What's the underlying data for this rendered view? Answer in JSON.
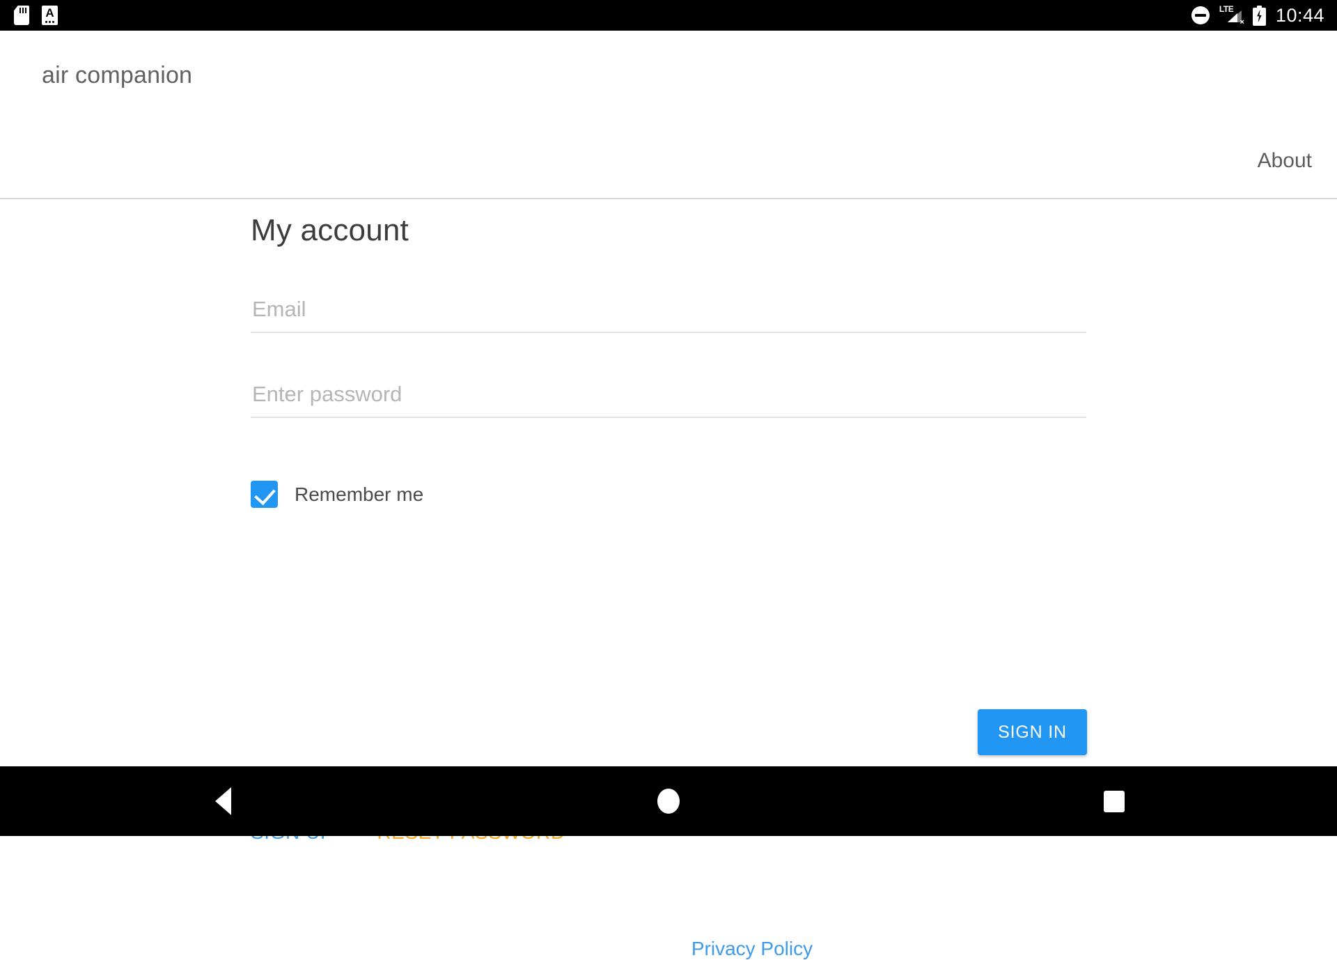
{
  "status_bar": {
    "icons_left": [
      "sd-card-icon",
      "document-a-icon"
    ],
    "icons_right": [
      "do-not-disturb-icon",
      "lte-signal-no-service-icon",
      "battery-charging-icon"
    ],
    "lte_label": "LTE",
    "signal_x": "×",
    "doc_letter": "A",
    "time": "10:44"
  },
  "header": {
    "brand": "air companion",
    "about_label": "About"
  },
  "main": {
    "title": "My account",
    "email": {
      "placeholder": "Email",
      "value": ""
    },
    "password": {
      "placeholder": "Enter password",
      "value": ""
    },
    "remember_me": {
      "label": "Remember me",
      "checked": "true"
    },
    "sign_in_label": "SIGN IN",
    "sign_up_label": "SIGN UP",
    "reset_password_label": "RESET PASSWORD",
    "privacy_policy_label": "Privacy Policy"
  },
  "nav_bar": {
    "back": "back-icon",
    "home": "home-icon",
    "recents": "recents-icon"
  },
  "colors": {
    "accent_blue": "#2196f3",
    "link_blue": "#3d9be9",
    "warning_orange": "#f5a623",
    "text_dark": "#3c3c3c",
    "text_muted": "#b5b5b5"
  }
}
